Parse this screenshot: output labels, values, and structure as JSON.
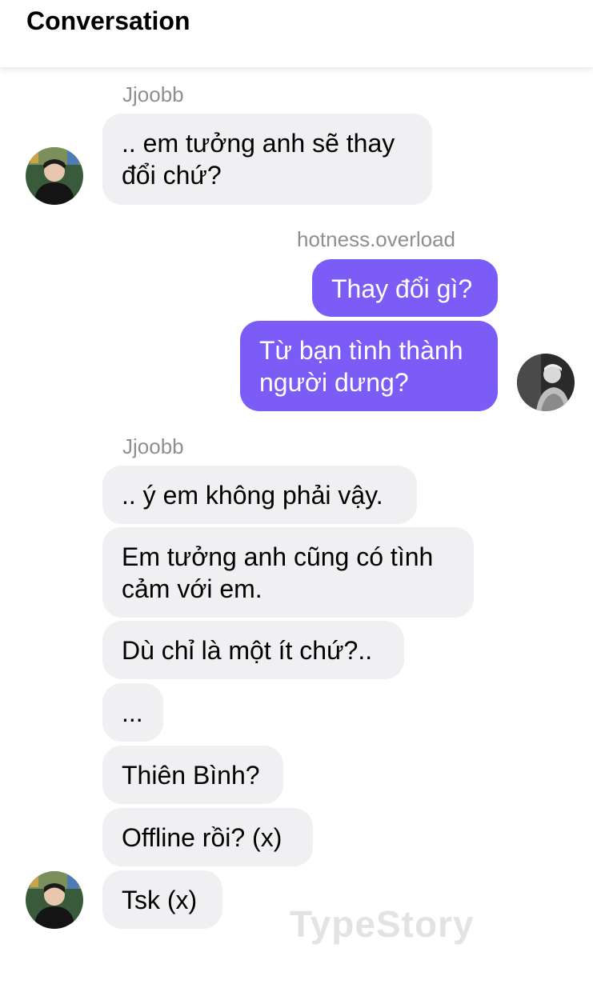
{
  "header": {
    "title": "Conversation"
  },
  "senders": {
    "jjoobb_1": "Jjoobb",
    "hotness": "hotness.overload",
    "jjoobb_2": "Jjoobb"
  },
  "messages": {
    "m1": ".. em tưởng anh sẽ thay\nđổi chứ?",
    "m2": "Thay đổi gì?",
    "m3": "Từ bạn tình thành\nngười dưng?",
    "m4": ".. ý em không phải vậy.",
    "m5": "Em tưởng anh cũng có tình\ncảm với em.",
    "m6": "Dù chỉ là một ít chứ?..",
    "m7": "...",
    "m8": "Thiên Bình?",
    "m9": "Offline rồi? (x)",
    "m10": "Tsk (x)"
  },
  "watermark": "TypeStory",
  "colors": {
    "outgoing_bubble": "#7b5cf6",
    "incoming_bubble": "#f0f0f3",
    "sender_label": "#8e8e93"
  }
}
